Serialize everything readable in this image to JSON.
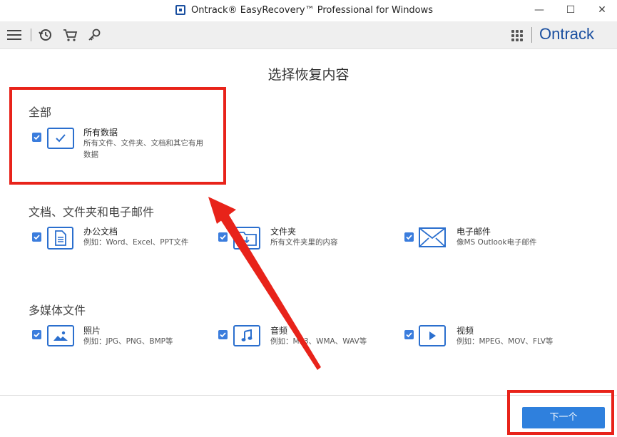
{
  "window": {
    "title": "Ontrack® EasyRecovery™ Professional for Windows",
    "minimize": "—",
    "maximize": "☐",
    "close": "✕"
  },
  "toolbar": {
    "brand": "Ontrack"
  },
  "page": {
    "title": "选择恢复内容",
    "next_label": "下一个"
  },
  "sections": {
    "all": {
      "title": "全部",
      "items": [
        {
          "title": "所有数据",
          "desc": "所有文件、文件夹、文档和其它有用数据",
          "icon": "checkmark-icon"
        }
      ]
    },
    "docs": {
      "title": "文档、文件夹和电子邮件",
      "items": [
        {
          "title": "办公文档",
          "desc": "例如：Word、Excel、PPT文件",
          "icon": "document-icon"
        },
        {
          "title": "文件夹",
          "desc": "所有文件夹里的内容",
          "icon": "folder-icon"
        },
        {
          "title": "电子邮件",
          "desc": "像MS Outlook电子邮件",
          "icon": "envelope-icon"
        }
      ]
    },
    "media": {
      "title": "多媒体文件",
      "items": [
        {
          "title": "照片",
          "desc": "例如：JPG、PNG、BMP等",
          "icon": "photo-icon"
        },
        {
          "title": "音频",
          "desc": "例如：MP3、WMA、WAV等",
          "icon": "music-note-icon"
        },
        {
          "title": "视频",
          "desc": "例如：MPEG、MOV、FLV等",
          "icon": "play-icon"
        }
      ]
    }
  },
  "colors": {
    "accent": "#2f80dd",
    "annotation": "#e8231a",
    "brand": "#1a4fa0"
  }
}
